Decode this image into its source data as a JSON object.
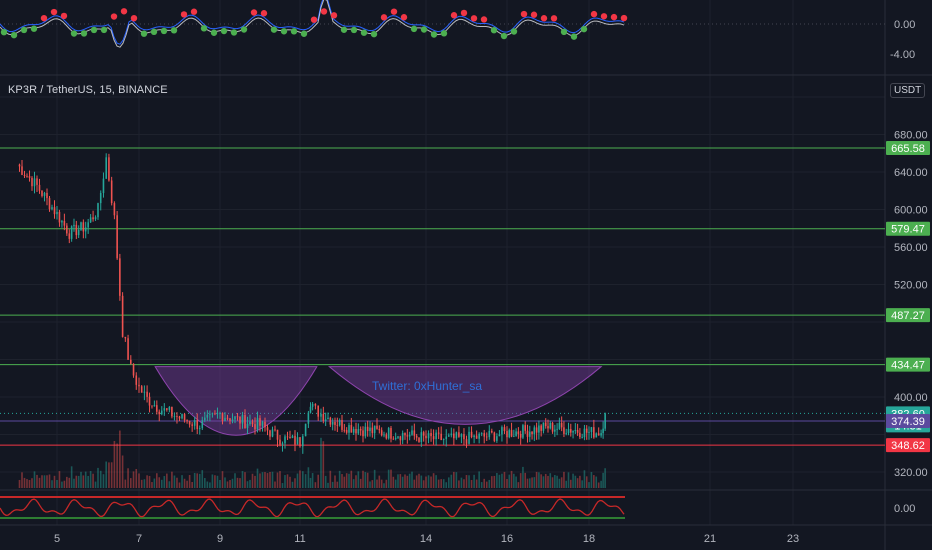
{
  "header": {
    "symbol": "KP3R / TetherUS, 15, BINANCE",
    "currency": "USDT"
  },
  "colors": {
    "background": "#131722",
    "up": "#26a69a",
    "down": "#ef5350",
    "level_line": "#4caf50",
    "support_line": "#f23645",
    "cup_fill": "#7b3fa0",
    "watermark": "#2f6fd6",
    "rsi_line": "#c62828",
    "rsi_band": "#2e7d32"
  },
  "watermark": "Twitter: 0xHunter_sa",
  "chart_data": [
    {
      "type": "line",
      "name": "main-price",
      "title": "KP3R / TetherUS, 15, BINANCE",
      "yticks": [
        320,
        360,
        400,
        440,
        480,
        520,
        560,
        600,
        640,
        680,
        720
      ],
      "yticks_visible_labels": [
        "320.00",
        "400.00",
        "520.00",
        "560.00",
        "600.00",
        "640.00",
        "680.00"
      ],
      "xticks": [
        "5",
        "7",
        "9",
        "11",
        "14",
        "16",
        "18",
        "21",
        "23"
      ],
      "x": [
        "4",
        "4.5",
        "5",
        "5.3",
        "5.7",
        "6",
        "6.2",
        "6.4",
        "6.6",
        "6.8",
        "7",
        "7.2",
        "7.5",
        "8",
        "8.5",
        "9",
        "9.5",
        "10",
        "10.5",
        "11",
        "11.2",
        "11.3",
        "11.5",
        "12",
        "12.5",
        "13",
        "13.5",
        "14",
        "14.5",
        "15",
        "15.5",
        "16",
        "16.5",
        "17",
        "17.5",
        "18",
        "18.3",
        "18.4"
      ],
      "close": [
        648,
        625,
        595,
        575,
        582,
        600,
        655,
        590,
        470,
        430,
        410,
        398,
        388,
        378,
        370,
        382,
        375,
        370,
        356,
        352,
        390,
        388,
        382,
        370,
        365,
        362,
        360,
        356,
        355,
        356,
        358,
        362,
        364,
        368,
        366,
        362,
        363,
        382.6
      ],
      "horizontal_levels": [
        665.58,
        579.47,
        487.27,
        434.47,
        348.62
      ],
      "price_labels": [
        {
          "value": 665.58,
          "label": "665.58",
          "color": "#4caf50"
        },
        {
          "value": 579.47,
          "label": "579.47",
          "color": "#4caf50"
        },
        {
          "value": 487.27,
          "label": "487.27",
          "color": "#4caf50"
        },
        {
          "value": 434.47,
          "label": "434.47",
          "color": "#4caf50"
        },
        {
          "value": 382.6,
          "label": "382.60",
          "color": "#26a69a",
          "countdown": "14:31"
        },
        {
          "value": 374.39,
          "label": "374.39",
          "color": "#5b4a9e"
        },
        {
          "value": 348.62,
          "label": "348.62",
          "color": "#f23645"
        }
      ],
      "annotation": "Twitter: 0xHunter_sa"
    },
    {
      "type": "line",
      "name": "top-oscillator",
      "yticks": [
        "0.00",
        "-4.00"
      ]
    },
    {
      "type": "line",
      "name": "bottom-oscillator",
      "yticks": [
        "0.00"
      ]
    }
  ]
}
